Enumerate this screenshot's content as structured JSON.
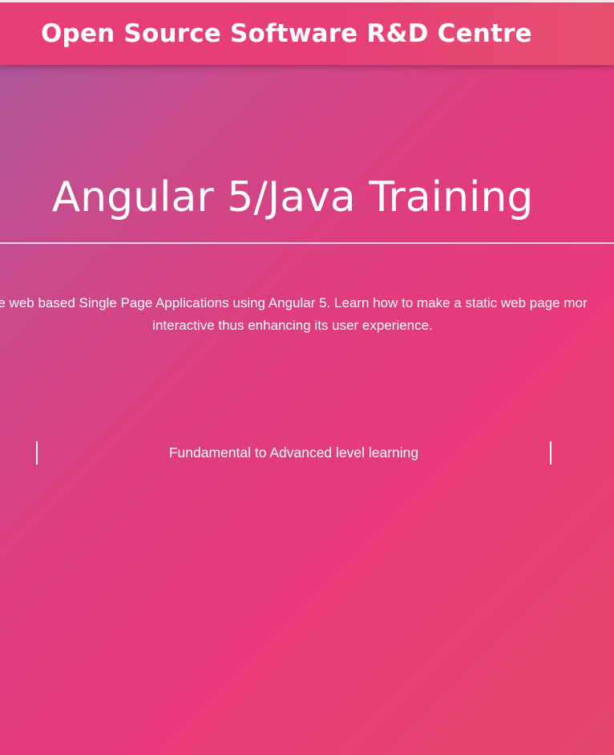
{
  "header": {
    "site_title": "Open Source Software R&D Centre"
  },
  "hero": {
    "course_title": "Angular 5/Java Training",
    "description_line1": "...e web based Single Page Applications using Angular 5. Learn how to make a static web page mor...",
    "description_line2": "interactive thus enhancing its user experience.",
    "tagline": "Fundamental to Advanced level learning"
  },
  "colors": {
    "header_bg": "#e83d79",
    "gradient_start": "#a55a9a",
    "gradient_mid": "#e83a78",
    "gradient_end": "#e5476e",
    "text": "#ffffff"
  }
}
